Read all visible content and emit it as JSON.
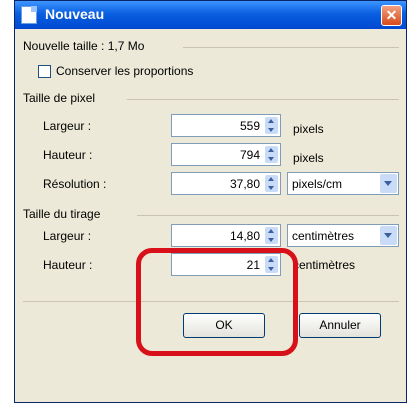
{
  "window": {
    "title": "Nouveau",
    "close_glyph": "✕"
  },
  "summary": {
    "label": "Nouvelle taille : 1,7 Mo"
  },
  "keep_proportions": {
    "label": "Conserver les proportions",
    "checked": false
  },
  "pixel_size": {
    "heading": "Taille de pixel",
    "width": {
      "label": "Largeur :",
      "value": "559",
      "unit": "pixels"
    },
    "height": {
      "label": "Hauteur :",
      "value": "794",
      "unit": "pixels"
    },
    "resolution": {
      "label": "Résolution :",
      "value": "37,80",
      "unit": "pixels/cm"
    }
  },
  "print_size": {
    "heading": "Taille du tirage",
    "width": {
      "label": "Largeur :",
      "value": "14,80",
      "unit": "centimètres"
    },
    "height": {
      "label": "Hauteur :",
      "value": "21",
      "unit": "centimètres"
    }
  },
  "buttons": {
    "ok": "OK",
    "cancel": "Annuler"
  },
  "colors": {
    "title_bar": "#0a5fe0",
    "highlight": "#d8101a",
    "dialog_bg": "#ece9d8"
  }
}
